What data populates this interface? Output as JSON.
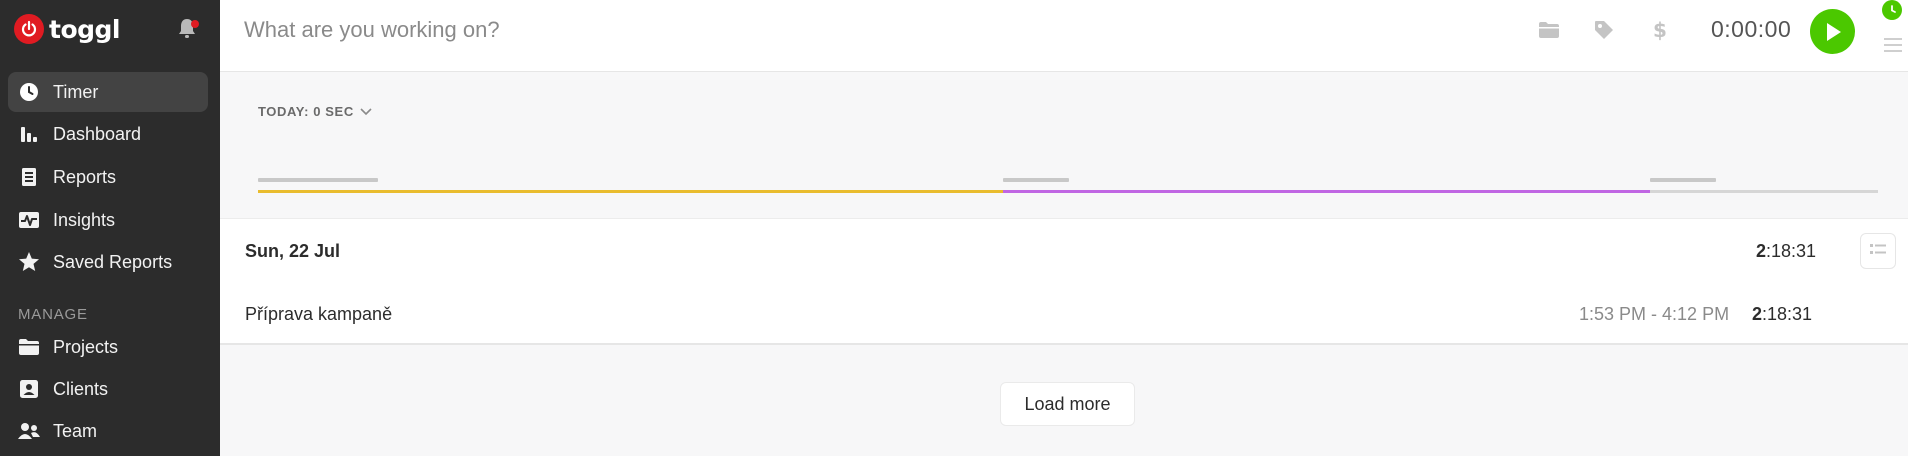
{
  "app": {
    "logo_text": "toggl"
  },
  "sidebar": {
    "items": [
      {
        "label": "Timer",
        "icon": "clock-icon"
      },
      {
        "label": "Dashboard",
        "icon": "bar-chart-icon"
      },
      {
        "label": "Reports",
        "icon": "document-icon"
      },
      {
        "label": "Insights",
        "icon": "pulse-icon"
      },
      {
        "label": "Saved Reports",
        "icon": "star-icon"
      }
    ],
    "manage_label": "MANAGE",
    "manage_items": [
      {
        "label": "Projects",
        "icon": "folder-icon"
      },
      {
        "label": "Clients",
        "icon": "contact-icon"
      },
      {
        "label": "Team",
        "icon": "people-icon"
      }
    ]
  },
  "timer": {
    "placeholder": "What are you working on?",
    "duration": "0:00:00"
  },
  "summary": {
    "today_label": "TODAY: 0 SEC",
    "bar_colors": [
      "#e9bc2e",
      "#c066e3",
      "#d6d6d6"
    ]
  },
  "day": {
    "date": "Sun, 22 Jul",
    "total_bold": "2",
    "total_rest": ":18:31",
    "entries": [
      {
        "description": "Příprava kampaně",
        "range": "1:53 PM - 4:12 PM",
        "dur_bold": "2",
        "dur_rest": ":18:31"
      }
    ]
  },
  "load_more_label": "Load more",
  "colors": {
    "sidebar_bg": "#2c2c2c",
    "brand_red": "#e01b22",
    "play_green": "#4bc800"
  }
}
